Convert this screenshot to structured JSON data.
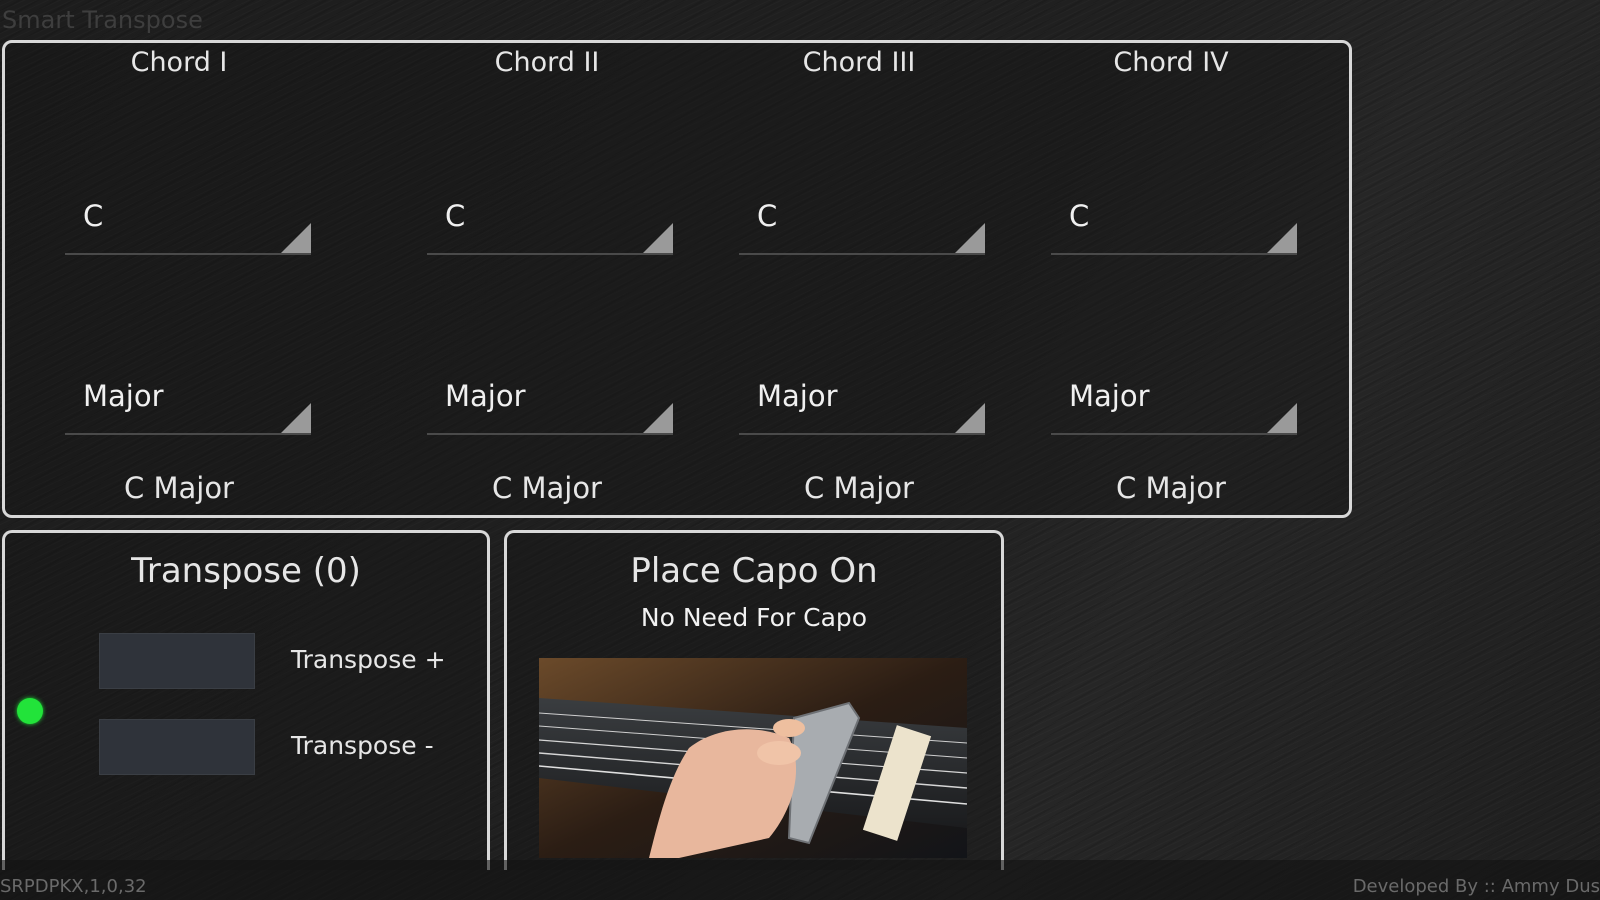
{
  "app": {
    "title": "Smart Transpose"
  },
  "chords": [
    {
      "title": "Chord I",
      "note": "C",
      "quality": "Major",
      "result": "C Major"
    },
    {
      "title": "Chord II",
      "note": "C",
      "quality": "Major",
      "result": "C Major"
    },
    {
      "title": "Chord III",
      "note": "C",
      "quality": "Major",
      "result": "C Major"
    },
    {
      "title": "Chord IV",
      "note": "C",
      "quality": "Major",
      "result": "C Major"
    }
  ],
  "transpose": {
    "title": "Transpose (0)",
    "plus_label": "Transpose +",
    "minus_label": "Transpose -"
  },
  "capo": {
    "title": "Place Capo On",
    "status": "No Need For Capo"
  },
  "footer": {
    "version": "SRPDPKX,1,0,32",
    "credit": "Developed By :: Ammy Dus"
  },
  "colors": {
    "indicator": "#22e33a",
    "panel_border": "#d8d8d8",
    "button_bg": "#2f333a"
  }
}
